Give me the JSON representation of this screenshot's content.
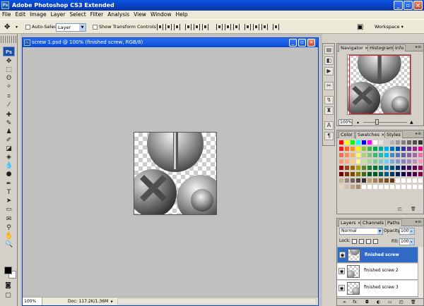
{
  "app": {
    "title": "Adobe Photoshop CS3 Extended",
    "logo": "Ps",
    "window_buttons": {
      "minimize": "_",
      "restore": "▫",
      "close": "×"
    }
  },
  "menu": [
    "File",
    "Edit",
    "Image",
    "Layer",
    "Select",
    "Filter",
    "Analysis",
    "View",
    "Window",
    "Help"
  ],
  "options_bar": {
    "auto_select_label": "Auto-Select:",
    "auto_select_value": "Layer",
    "show_transform_label": "Show Transform Controls",
    "workspace_label": "Workspace ▾"
  },
  "document": {
    "title": "screw 1.psd @ 100% (finished screw, RGB/8)",
    "zoom": "100%",
    "doc_info": "Doc: 117.2K/1.36M",
    "status_arrow": "▸",
    "window_buttons": {
      "minimize": "_",
      "restore": "▫",
      "close": "×"
    }
  },
  "navigator": {
    "tabs": [
      "Navigator ×",
      "Histogram",
      "Info"
    ],
    "zoom": "100%",
    "zoom_out": "▴",
    "zoom_in": "▲"
  },
  "swatches": {
    "tabs": [
      "Color",
      "Swatches ×",
      "Styles"
    ]
  },
  "layers": {
    "tabs": [
      "Layers ×",
      "Channels",
      "Paths"
    ],
    "blend_mode": "Normal",
    "opacity_label": "Opacity:",
    "opacity": "100%",
    "lock_label": "Lock:",
    "fill_label": "Fill:",
    "fill": "100%",
    "items": [
      {
        "name": "finished screw",
        "selected": true
      },
      {
        "name": "finished screw 2",
        "selected": false
      },
      {
        "name": "finished screw 3",
        "selected": false
      }
    ],
    "footer_icons": [
      "link-icon",
      "fx-icon",
      "mask-icon",
      "adjustment-icon",
      "group-icon",
      "new-layer-icon",
      "trash-icon"
    ]
  },
  "colors": {
    "title_bar": "#0a4ad4",
    "selected_layer": "#3169c6",
    "navigator_frame": "#e02020",
    "foreground": "#000000",
    "background": "#ffffff"
  }
}
